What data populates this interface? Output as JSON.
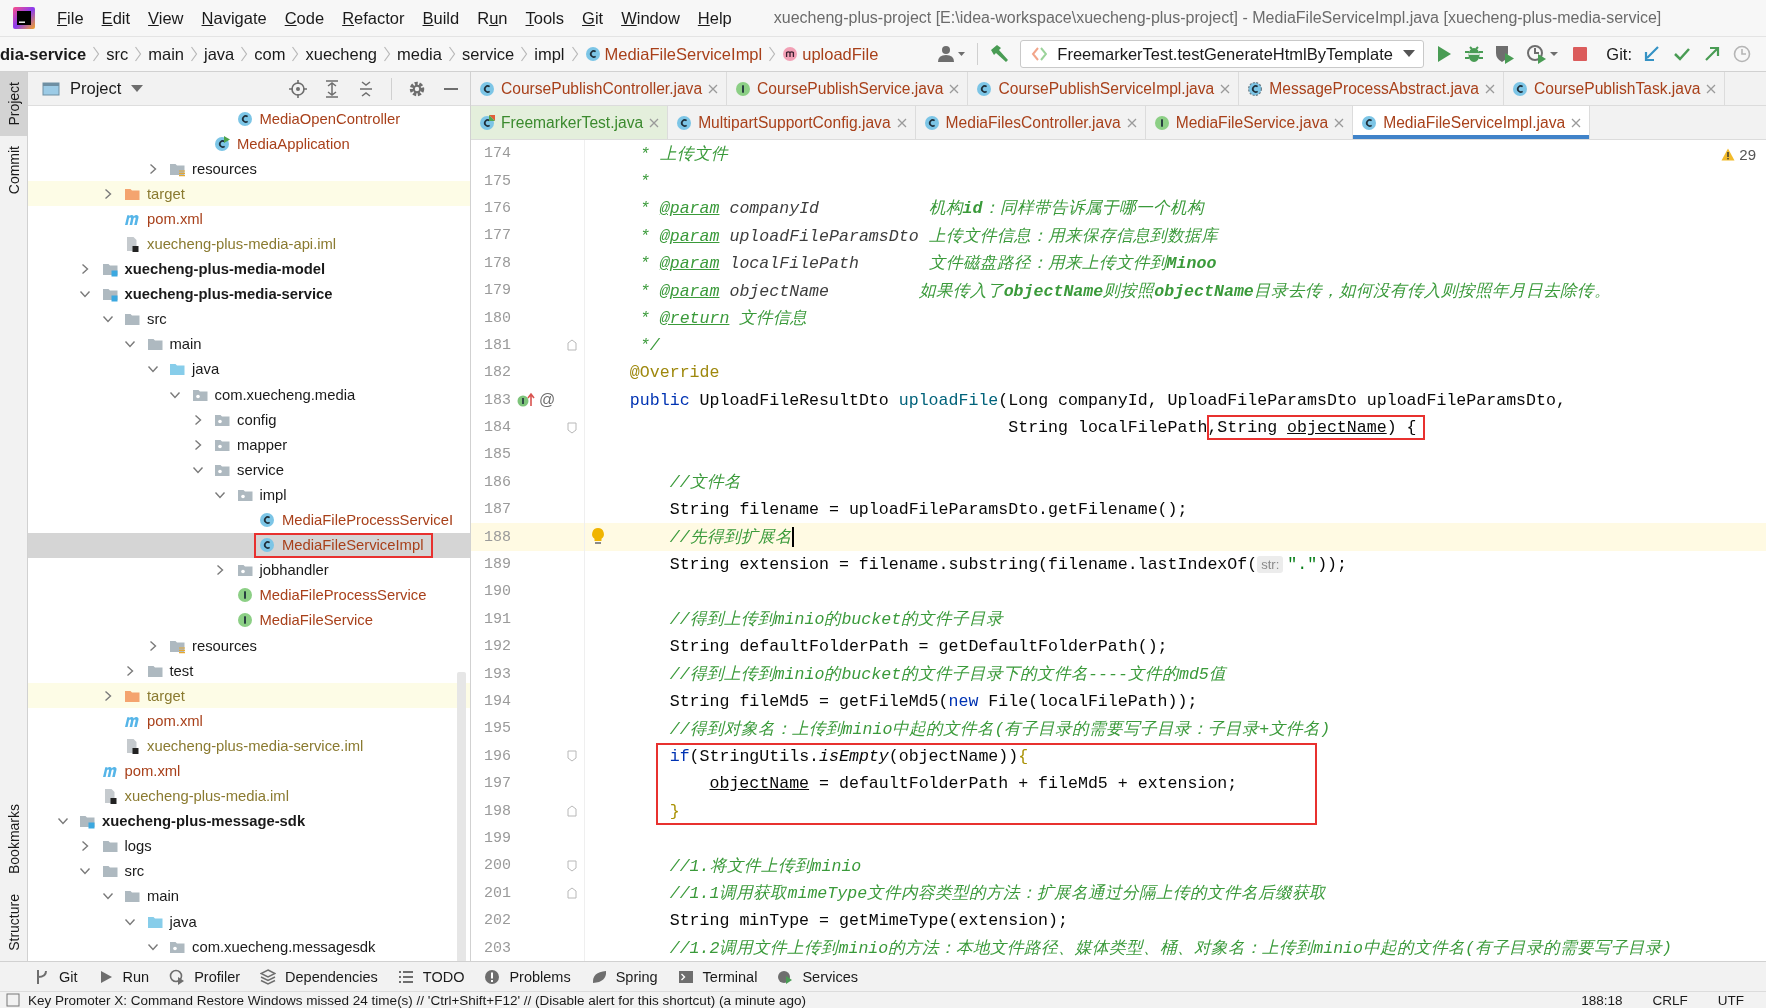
{
  "menu_bar": {
    "items": [
      {
        "key": "F",
        "rest": "ile"
      },
      {
        "key": "E",
        "rest": "dit"
      },
      {
        "key": "V",
        "rest": "iew"
      },
      {
        "key": "N",
        "rest": "avigate"
      },
      {
        "key": "C",
        "rest": "ode"
      },
      {
        "key": "R",
        "rest": "efactor"
      },
      {
        "key": "B",
        "rest": "uild"
      },
      {
        "pre": "R",
        "key": "u",
        "rest": "n"
      },
      {
        "key": "T",
        "rest": "ools"
      },
      {
        "key": "G",
        "rest": "it"
      },
      {
        "key": "W",
        "rest": "indow"
      },
      {
        "key": "H",
        "rest": "elp"
      }
    ],
    "title": "xuecheng-plus-project [E:\\idea-workspace\\xuecheng-plus-project] - MediaFileServiceImpl.java [xuecheng-plus-media-service]"
  },
  "nav_bar": {
    "breadcrumbs": [
      {
        "label": "dia-service",
        "kind": "module"
      },
      {
        "label": "src",
        "kind": "folder"
      },
      {
        "label": "main",
        "kind": "folder"
      },
      {
        "label": "java",
        "kind": "folder"
      },
      {
        "label": "com",
        "kind": "folder"
      },
      {
        "label": "xuecheng",
        "kind": "folder"
      },
      {
        "label": "media",
        "kind": "folder"
      },
      {
        "label": "service",
        "kind": "folder"
      },
      {
        "label": "impl",
        "kind": "folder"
      },
      {
        "label": "MediaFileServiceImpl",
        "kind": "class"
      },
      {
        "label": "uploadFile",
        "kind": "method"
      }
    ],
    "run_config": "FreemarkerTest.testGenerateHtmlByTemplate",
    "git_label": "Git:"
  },
  "left_stripe": {
    "top": [
      {
        "label": "Project",
        "selected": true
      },
      {
        "label": "Commit",
        "selected": false
      }
    ],
    "bottom": [
      {
        "label": "Bookmarks",
        "selected": false
      },
      {
        "label": "Structure",
        "selected": false
      }
    ]
  },
  "project_panel": {
    "title": "Project",
    "tree": [
      {
        "children": [
          {
            "children": [
              {
                "children": [
                  {
                    "children": [
                      {
                        "children": [
                          {
                            "children": [
                              {
                                "children": [
                                  {
                                    "label": "MediaOpenController",
                                    "kind": "class",
                                    "selected": false
                                  }
                                ]
                              },
                              {
                                "label": "MediaApplication",
                                "kind": "app",
                                "selected": false
                              }
                            ]
                          }
                        ]
                      },
                      {
                        "label": "resources",
                        "kind": "resources",
                        "expanded": false,
                        "selected": false
                      }
                    ]
                  }
                ]
              },
              {
                "label": "target",
                "kind": "excluded",
                "expanded": false,
                "selected": false
              },
              {
                "label": "pom.xml",
                "kind": "maven",
                "selected": false
              },
              {
                "label": "xuecheng-plus-media-api.iml",
                "kind": "iml",
                "selected": false
              }
            ]
          },
          {
            "label": "xuecheng-plus-media-model",
            "kind": "module",
            "expanded": false,
            "selected": false
          },
          {
            "label": "xuecheng-plus-media-service",
            "kind": "module",
            "expanded": true,
            "selected": false,
            "children": [
              {
                "label": "src",
                "kind": "folder",
                "expanded": true,
                "selected": false,
                "children": [
                  {
                    "label": "main",
                    "kind": "folder",
                    "expanded": true,
                    "selected": false,
                    "children": [
                      {
                        "label": "java",
                        "kind": "source",
                        "expanded": true,
                        "selected": false,
                        "children": [
                          {
                            "label": "com.xuecheng.media",
                            "kind": "package",
                            "expanded": true,
                            "selected": false,
                            "children": [
                              {
                                "label": "config",
                                "kind": "package",
                                "expanded": false,
                                "selected": false
                              },
                              {
                                "label": "mapper",
                                "kind": "package",
                                "expanded": false,
                                "selected": false
                              },
                              {
                                "label": "service",
                                "kind": "package",
                                "expanded": true,
                                "selected": false,
                                "children": [
                                  {
                                    "label": "impl",
                                    "kind": "package",
                                    "expanded": true,
                                    "selected": false,
                                    "children": [
                                      {
                                        "label": "MediaFileProcessServiceI",
                                        "kind": "class",
                                        "selected": false
                                      },
                                      {
                                        "label": "MediaFileServiceImpl",
                                        "kind": "class",
                                        "selected": true,
                                        "boxed": true
                                      }
                                    ]
                                  },
                                  {
                                    "label": "jobhandler",
                                    "kind": "package",
                                    "expanded": false,
                                    "selected": false
                                  },
                                  {
                                    "label": "MediaFileProcessService",
                                    "kind": "interface",
                                    "selected": false
                                  },
                                  {
                                    "label": "MediaFileService",
                                    "kind": "interface",
                                    "selected": false
                                  }
                                ]
                              }
                            ]
                          }
                        ]
                      },
                      {
                        "label": "resources",
                        "kind": "resources",
                        "expanded": false,
                        "selected": false
                      }
                    ]
                  },
                  {
                    "label": "test",
                    "kind": "folder",
                    "expanded": false,
                    "selected": false
                  }
                ]
              },
              {
                "label": "target",
                "kind": "excluded",
                "expanded": false,
                "selected": false
              },
              {
                "label": "pom.xml",
                "kind": "maven",
                "selected": false
              },
              {
                "label": "xuecheng-plus-media-service.iml",
                "kind": "iml",
                "selected": false
              }
            ]
          },
          {
            "label": "pom.xml",
            "kind": "maven",
            "selected": false
          },
          {
            "label": "xuecheng-plus-media.iml",
            "kind": "iml",
            "selected": false
          }
        ]
      },
      {
        "label": "xuecheng-plus-message-sdk",
        "kind": "module",
        "expanded": true,
        "selected": false,
        "children": [
          {
            "label": "logs",
            "kind": "folder",
            "expanded": false,
            "selected": false
          },
          {
            "label": "src",
            "kind": "folder",
            "expanded": true,
            "selected": false,
            "children": [
              {
                "label": "main",
                "kind": "folder",
                "expanded": true,
                "selected": false,
                "children": [
                  {
                    "label": "java",
                    "kind": "source",
                    "expanded": true,
                    "selected": false,
                    "children": [
                      {
                        "label": "com.xuecheng.messagesdk",
                        "kind": "package",
                        "expanded": true,
                        "selected": false
                      }
                    ]
                  }
                ]
              }
            ]
          }
        ]
      }
    ]
  },
  "editor": {
    "tab_rows": [
      {
        "tabs": [
          {
            "label": "CoursePublishController.java",
            "kind": "class",
            "selected": false
          },
          {
            "label": "CoursePublishService.java",
            "kind": "interface",
            "selected": false
          },
          {
            "label": "CoursePublishServiceImpl.java",
            "kind": "class",
            "selected": false
          },
          {
            "label": "MessageProcessAbstract.java",
            "kind": "abstract",
            "selected": false
          },
          {
            "label": "CoursePublishTask.java",
            "kind": "class",
            "selected": false
          }
        ]
      },
      {
        "tabs": [
          {
            "label": "FreemarkerTest.java",
            "kind": "test",
            "selected": false
          },
          {
            "label": "MultipartSupportConfig.java",
            "kind": "class",
            "selected": false
          },
          {
            "label": "MediaFilesController.java",
            "kind": "class",
            "selected": false
          },
          {
            "label": "MediaFileService.java",
            "kind": "interface",
            "selected": false
          },
          {
            "label": "MediaFileServiceImpl.java",
            "kind": "class",
            "selected": true
          }
        ]
      }
    ],
    "warning_count": "29",
    "lines": [
      {
        "number": "174",
        "kind": "plain",
        "segments": [
          {
            "text": "     * 上传文件",
            "kind": "comment"
          }
        ]
      },
      {
        "number": "175",
        "kind": "plain",
        "segments": [
          {
            "text": "     *",
            "kind": "comment"
          }
        ]
      },
      {
        "number": "176",
        "kind": "plain",
        "segments": [
          {
            "text": "     * ",
            "kind": "comment"
          },
          {
            "text": "@param",
            "kind": "doctag"
          },
          {
            "text": " companyId",
            "kind": "docname"
          },
          {
            "text": "           机构",
            "kind": "comment"
          },
          {
            "text": "id",
            "kind": "docbold"
          },
          {
            "text": "：同样带告诉属于哪一个机构",
            "kind": "comment"
          }
        ]
      },
      {
        "number": "177",
        "kind": "plain",
        "segments": [
          {
            "text": "     * ",
            "kind": "comment"
          },
          {
            "text": "@param",
            "kind": "doctag"
          },
          {
            "text": " uploadFileParamsDto",
            "kind": "docname"
          },
          {
            "text": " 上传文件信息：用来保存信息到数据库",
            "kind": "comment"
          }
        ]
      },
      {
        "number": "178",
        "kind": "plain",
        "segments": [
          {
            "text": "     * ",
            "kind": "comment"
          },
          {
            "text": "@param",
            "kind": "doctag"
          },
          {
            "text": " localFilePath",
            "kind": "docname"
          },
          {
            "text": "       文件磁盘路径：用来上传文件到",
            "kind": "comment"
          },
          {
            "text": "Minoo",
            "kind": "docbold"
          }
        ]
      },
      {
        "number": "179",
        "kind": "plain",
        "segments": [
          {
            "text": "     * ",
            "kind": "comment"
          },
          {
            "text": "@param",
            "kind": "doctag"
          },
          {
            "text": " objectName",
            "kind": "docname"
          },
          {
            "text": "         如果传入了",
            "kind": "comment"
          },
          {
            "text": "objectName",
            "kind": "docbold"
          },
          {
            "text": "则按照",
            "kind": "comment"
          },
          {
            "text": "objectName",
            "kind": "docbold"
          },
          {
            "text": "目录去传，如何没有传入则按照年月日去除传。",
            "kind": "comment"
          }
        ]
      },
      {
        "number": "180",
        "kind": "plain",
        "segments": [
          {
            "text": "     * ",
            "kind": "comment"
          },
          {
            "text": "@return",
            "kind": "doctag"
          },
          {
            "text": " 文件信息",
            "kind": "comment"
          }
        ]
      },
      {
        "number": "181",
        "kind": "fold-end",
        "segments": [
          {
            "text": "     */",
            "kind": "comment"
          }
        ]
      },
      {
        "number": "182",
        "kind": "plain",
        "segments": [
          {
            "text": "    @Override",
            "kind": "annotation"
          }
        ]
      },
      {
        "number": "183",
        "kind": "implements",
        "gutter_symbol": "@",
        "segments": [
          {
            "text": "    public",
            "kind": "keyword"
          },
          {
            "text": " UploadFileResultDto ",
            "kind": "plain"
          },
          {
            "text": "uploadFile",
            "kind": "method"
          },
          {
            "text": "(Long companyId, UploadFileParamsDto uploadFileParamsDto,",
            "kind": "plain"
          }
        ]
      },
      {
        "number": "184",
        "kind": "fold-start",
        "segments": [
          {
            "text": "                                          String localFilePath",
            "kind": "plain"
          },
          {
            "text": ",String ",
            "kind": "plain",
            "boxed": true
          },
          {
            "text": "objectName",
            "kind": "param",
            "boxed": true
          },
          {
            "text": ") {",
            "kind": "plain",
            "boxed": true
          }
        ]
      },
      {
        "number": "185",
        "kind": "plain"
      },
      {
        "number": "186",
        "kind": "plain",
        "segments": [
          {
            "text": "        //文件名",
            "kind": "comment"
          }
        ]
      },
      {
        "number": "187",
        "kind": "plain",
        "segments": [
          {
            "text": "        String filename = uploadFileParamsDto.getFilename();",
            "kind": "plain"
          }
        ]
      },
      {
        "number": "188",
        "kind": "bulb",
        "current": true,
        "segments": [
          {
            "text": "        //先得到扩展名",
            "kind": "comment"
          }
        ]
      },
      {
        "number": "189",
        "kind": "plain",
        "segments": [
          {
            "text": "        String extension = filename.substring(filename.lastIndexOf(",
            "kind": "plain"
          },
          {
            "text": "str:",
            "kind": "hint"
          },
          {
            "text": "\".\"",
            "kind": "string"
          },
          {
            "text": "));",
            "kind": "plain"
          }
        ]
      },
      {
        "number": "190",
        "kind": "plain"
      },
      {
        "number": "191",
        "kind": "plain",
        "segments": [
          {
            "text": "        //得到上传到minio的bucket的文件子目录",
            "kind": "comment"
          }
        ]
      },
      {
        "number": "192",
        "kind": "plain",
        "segments": [
          {
            "text": "        String defaultFolderPath = getDefaultFolderPath();",
            "kind": "plain"
          }
        ]
      },
      {
        "number": "193",
        "kind": "plain",
        "segments": [
          {
            "text": "        //得到上传到minio的bucket的文件子目录下的文件名----文件的md5值",
            "kind": "comment"
          }
        ]
      },
      {
        "number": "194",
        "kind": "plain",
        "segments": [
          {
            "text": "        String fileMd5 = getFileMd5(",
            "kind": "plain"
          },
          {
            "text": "new",
            "kind": "keyword"
          },
          {
            "text": " File(localFilePath));",
            "kind": "plain"
          }
        ]
      },
      {
        "number": "195",
        "kind": "plain",
        "segments": [
          {
            "text": "        //得到对象名：上传到minio中起的文件名(有子目录的需要写子目录：子目录+文件名)",
            "kind": "comment"
          }
        ]
      },
      {
        "number": "196",
        "kind": "fold-start",
        "boxed": true,
        "segments": [
          {
            "text": "        if",
            "kind": "keyword"
          },
          {
            "text": "(StringUtils.",
            "kind": "plain"
          },
          {
            "text": "isEmpty",
            "kind": "static"
          },
          {
            "text": "(objectName))",
            "kind": "plain"
          },
          {
            "text": "{",
            "kind": "brace"
          }
        ]
      },
      {
        "number": "197",
        "kind": "plain",
        "boxed": true,
        "segments": [
          {
            "text": "            objectName",
            "kind": "param"
          },
          {
            "text": " = defaultFolderPath + fileMd5 + extension;",
            "kind": "plain"
          }
        ]
      },
      {
        "number": "198",
        "kind": "fold-end",
        "boxed": true,
        "segments": [
          {
            "text": "        }",
            "kind": "brace"
          }
        ]
      },
      {
        "number": "199",
        "kind": "plain"
      },
      {
        "number": "200",
        "kind": "fold-start",
        "segments": [
          {
            "text": "        //1.将文件上传到minio",
            "kind": "comment"
          }
        ]
      },
      {
        "number": "201",
        "kind": "fold-end",
        "segments": [
          {
            "text": "        //1.1调用获取mimeType文件内容类型的方法：扩展名通过分隔上传的文件名后缀获取",
            "kind": "comment"
          }
        ]
      },
      {
        "number": "202",
        "kind": "plain",
        "segments": [
          {
            "text": "        String minType = getMimeType(extension);",
            "kind": "plain"
          }
        ]
      },
      {
        "number": "203",
        "kind": "plain",
        "segments": [
          {
            "text": "        //1.2调用文件上传到minio的方法：本地文件路径、媒体类型、桶、对象名：上传到minio中起的文件名(有子目录的需要写子目录)",
            "kind": "comment"
          }
        ]
      }
    ]
  },
  "tool_windows": [
    {
      "label": "Git",
      "kind": "git"
    },
    {
      "label": "Run",
      "kind": "run"
    },
    {
      "label": "Profiler",
      "kind": "profiler"
    },
    {
      "label": "Dependencies",
      "kind": "dependencies"
    },
    {
      "label": "TODO",
      "kind": "todo"
    },
    {
      "label": "Problems",
      "kind": "problems"
    },
    {
      "label": "Spring",
      "kind": "spring"
    },
    {
      "label": "Terminal",
      "kind": "terminal"
    },
    {
      "label": "Services",
      "kind": "services"
    }
  ],
  "status_bar": {
    "message": "Key Promoter X: Command Restore Windows missed 24 time(s) // 'Ctrl+Shift+F12' // (Disable alert for this shortcut) (a minute ago)",
    "position": "188:18",
    "line_separator": "CRLF",
    "encoding": "UTF"
  }
}
